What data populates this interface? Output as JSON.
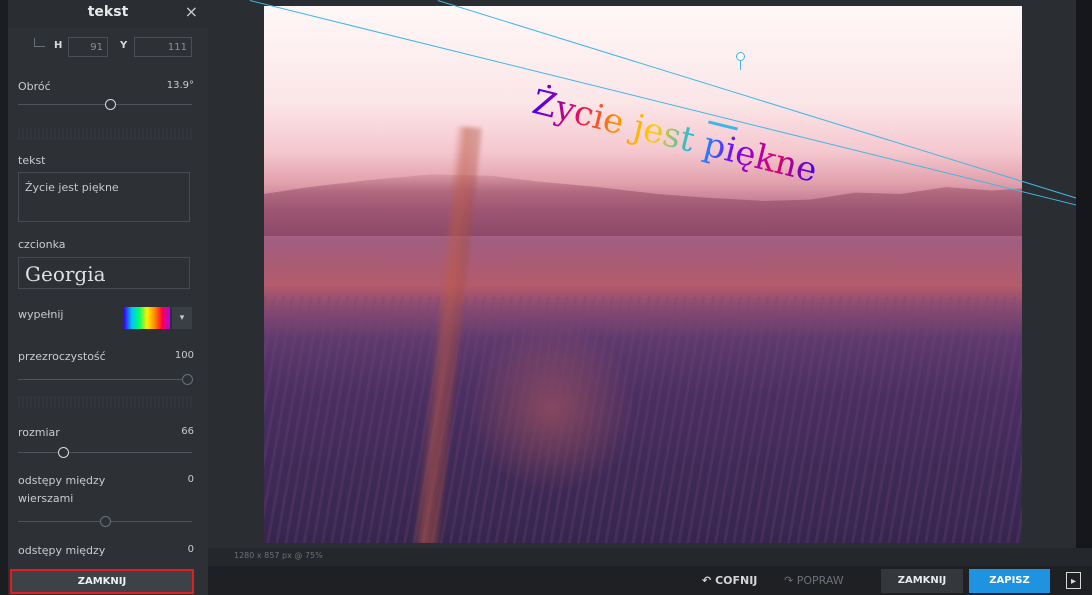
{
  "panel": {
    "title": "tekst",
    "close_icon": "×",
    "h_label": "H",
    "h_value": "91",
    "y_label": "Y",
    "y_value": "111",
    "rotate_label": "Obróć",
    "rotate_value": "13.9°",
    "rotate_fraction": 0.5,
    "text_label": "tekst",
    "text_value": "Życie jest piękne",
    "font_label": "czcionka",
    "font_value": "Georgia",
    "fill_label": "wypełnij",
    "fill_dropdown_icon": "▾",
    "opacity_label": "przezroczystość",
    "opacity_value": "100",
    "size_label": "rozmiar",
    "size_value": "66",
    "line_spacing_label_1": "odstępy między",
    "line_spacing_label_2": "wierszami",
    "line_spacing_value": "0",
    "letter_spacing_label": "odstępy między",
    "letter_spacing_value": "0",
    "close_button": "ZAMKNIJ"
  },
  "canvas": {
    "text": "Życie jest piękne",
    "info": "1280 x 857 px @ 75%"
  },
  "toolbar": {
    "undo_icon": "↶",
    "undo_label": "COFNIJ",
    "redo_icon": "↷",
    "redo_label": "POPRAW",
    "close_label": "ZAMKNIJ",
    "save_label": "ZAPISZ",
    "toggle_icon": "▸"
  },
  "colors": {
    "panel_bg": "#2d3136",
    "accent_blue": "#1f92e0",
    "highlight_red": "#e01e1e"
  },
  "icons": {
    "panel_close": "close-icon",
    "undo": "undo-icon",
    "redo": "redo-icon",
    "fill_dropdown": "chevron-down-icon",
    "toggle": "panel-toggle-icon"
  }
}
